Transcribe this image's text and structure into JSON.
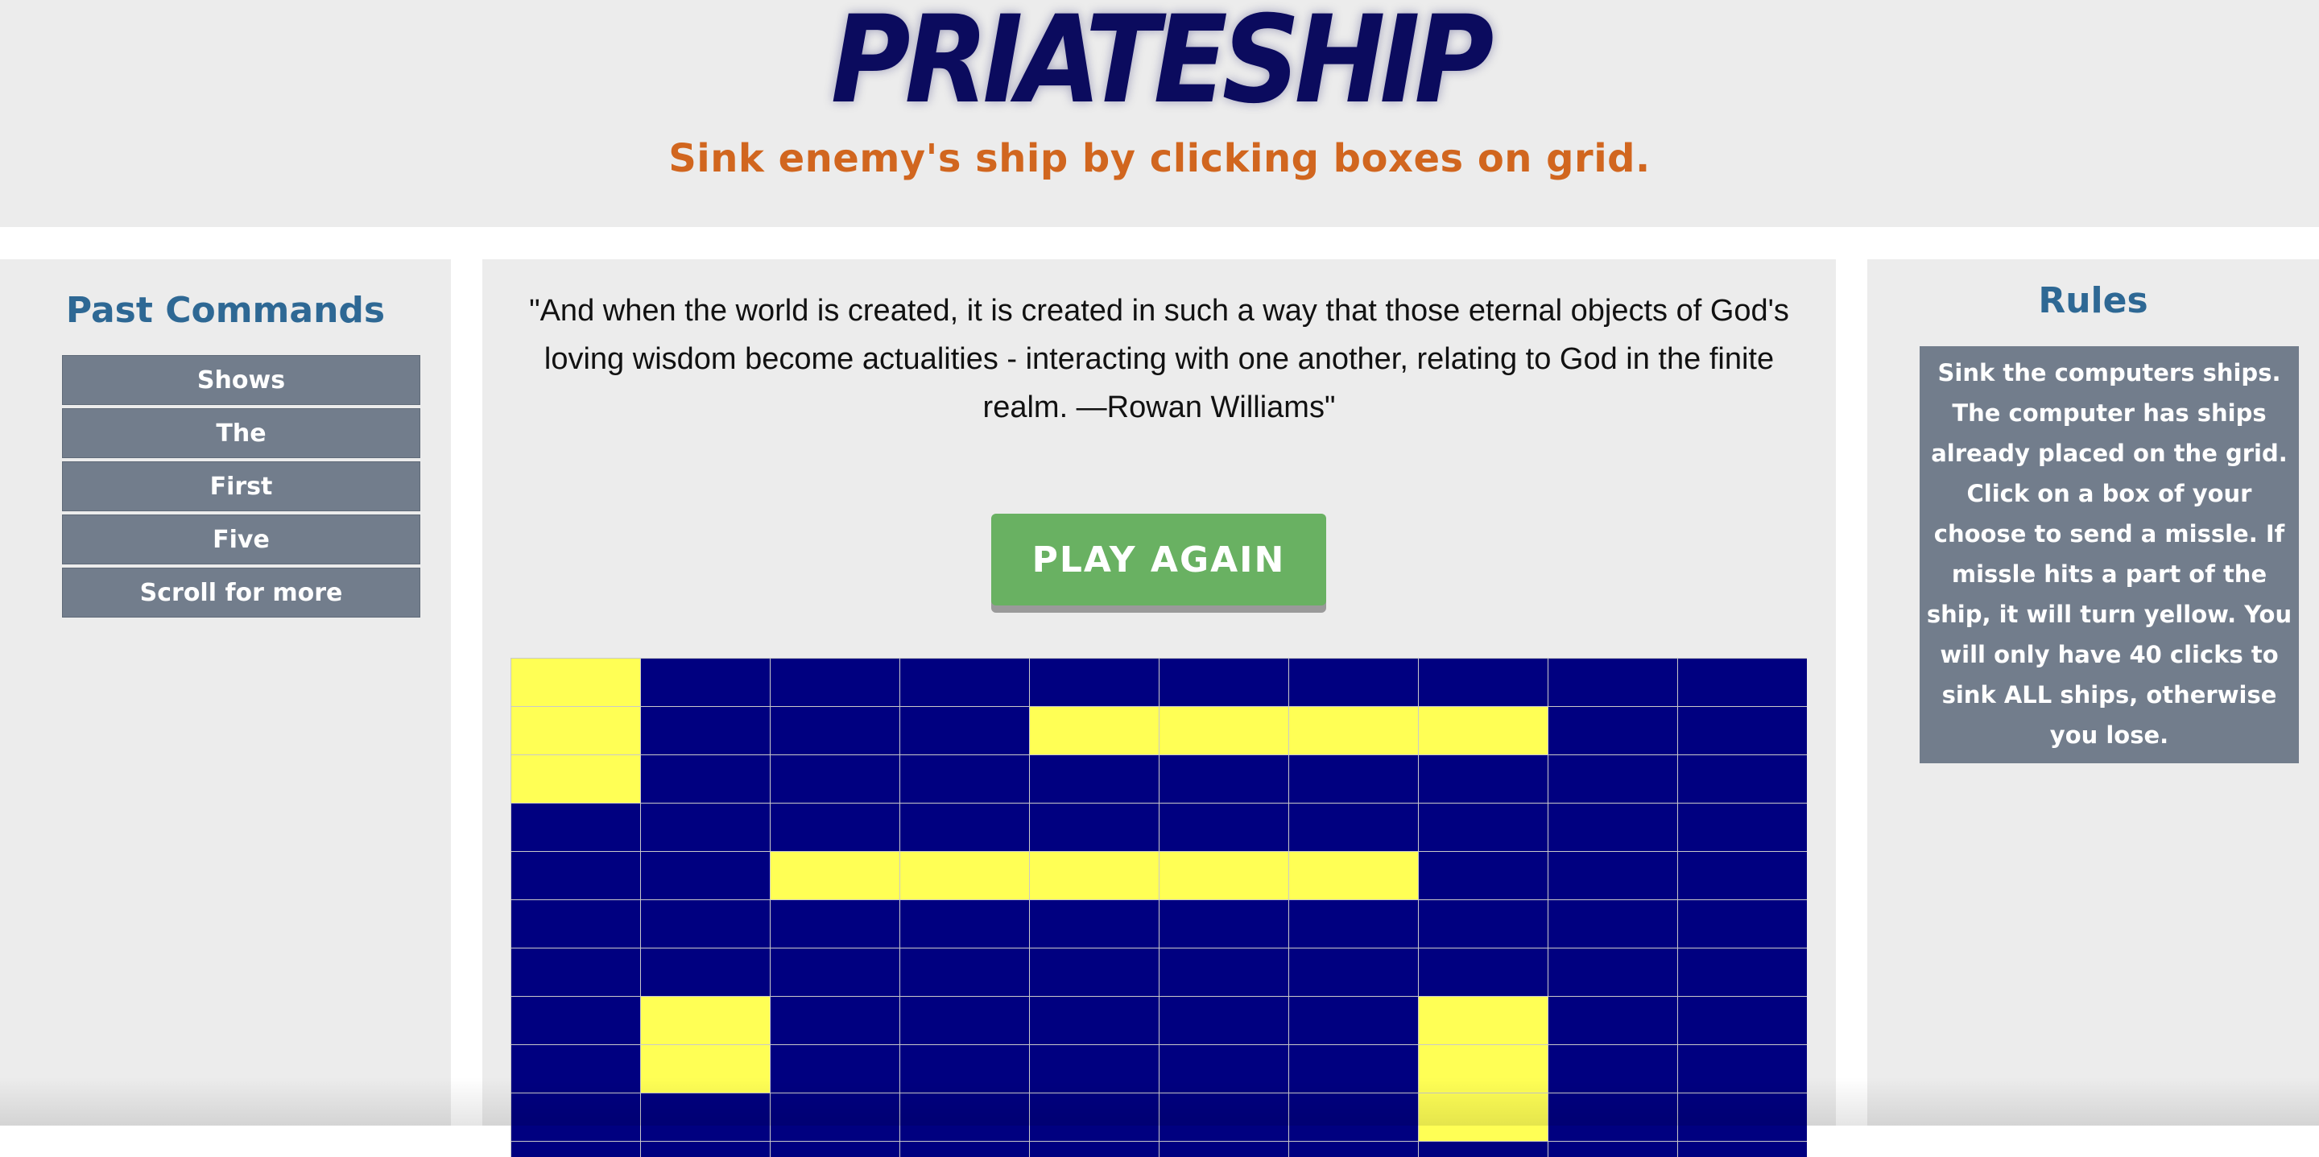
{
  "header": {
    "title": "PRIATESHIP",
    "subtitle": "Sink enemy's ship by clicking boxes on grid."
  },
  "past_commands": {
    "title": "Past Commands",
    "items": [
      "Shows",
      "The",
      "First",
      "Five",
      "Scroll for more"
    ]
  },
  "quote": {
    "text": "\"And when the world is created, it is created in such a way that those eternal objects of God's loving wisdom become actualities - interacting with one another, relating to God in the finite realm. —Rowan Williams\""
  },
  "actions": {
    "play_again_label": "PLAY AGAIN"
  },
  "rules": {
    "title": "Rules",
    "text": "Sink the computers ships. The computer has ships already placed on the grid. Click on a box of your choose to send a missle. If missle hits a part of the ship, it will turn yellow. You will only have 40 clicks to sink ALL ships, otherwise you lose."
  },
  "grid": {
    "colors": {
      "water": "#000080",
      "hit": "#ffff55"
    },
    "rows": [
      [
        1,
        0,
        0,
        0,
        0,
        0,
        0,
        0,
        0,
        0
      ],
      [
        1,
        0,
        0,
        0,
        1,
        1,
        1,
        1,
        0,
        0
      ],
      [
        1,
        0,
        0,
        0,
        0,
        0,
        0,
        0,
        0,
        0
      ],
      [
        0,
        0,
        0,
        0,
        0,
        0,
        0,
        0,
        0,
        0
      ],
      [
        0,
        0,
        1,
        1,
        1,
        1,
        1,
        0,
        0,
        0
      ],
      [
        0,
        0,
        0,
        0,
        0,
        0,
        0,
        0,
        0,
        0
      ],
      [
        0,
        0,
        0,
        0,
        0,
        0,
        0,
        0,
        0,
        0
      ],
      [
        0,
        1,
        0,
        0,
        0,
        0,
        0,
        1,
        0,
        0
      ],
      [
        0,
        1,
        0,
        0,
        0,
        0,
        0,
        1,
        0,
        0
      ],
      [
        0,
        0,
        0,
        0,
        0,
        0,
        0,
        1,
        0,
        0
      ],
      [
        0,
        0,
        0,
        0,
        0,
        0,
        0,
        0,
        0,
        0
      ]
    ]
  }
}
